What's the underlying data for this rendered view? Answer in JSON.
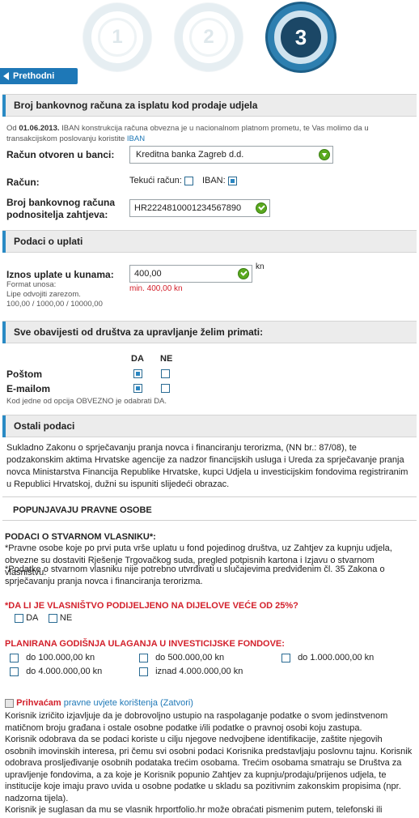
{
  "steps": [
    {
      "label": "1",
      "state": "done"
    },
    {
      "label": "2",
      "state": "done"
    },
    {
      "label": "3",
      "state": "active"
    }
  ],
  "back_button": "Prethodni korak",
  "bank_section": {
    "title": "Broj bankovnog računa za isplatu kod prodaje udjela",
    "note_prefix": "Od",
    "note_date": "01.06.2013.",
    "note_text": "IBAN konstrukcija računa obvezna je u nacionalnom platnom prometu, te Vas molimo da u transakcijskom poslovanju koristite",
    "note_link": "IBAN",
    "bank_label": "Račun otvoren u banci:",
    "bank_value": "Kreditna banka Zagreb d.d.",
    "account_label": "Račun:",
    "tekuci_label": "Tekući račun:",
    "tekuci_checked": false,
    "iban_label": "IBAN:",
    "iban_checked": true,
    "number_label_1": "Broj bankovnog računa",
    "number_label_2": "podnositelja zahtjeva:",
    "number_value": "HR2224810001234567890"
  },
  "payment_section": {
    "title": "Podaci o uplati",
    "amount_label": "Iznos uplate u kunama:",
    "amount_value": "400,00",
    "currency": "kn",
    "format_1": "Format unosa:",
    "format_2": "Lipe odvojiti zarezom.",
    "format_3": "100,00 / 1000,00 / 10000,00",
    "min_note": "min. 400,00 kn"
  },
  "notify_section": {
    "title": "Sve obavijesti od društva za upravljanje želim primati:",
    "col_yes": "DA",
    "col_no": "NE",
    "rows": [
      {
        "label": "Poštom",
        "yes": true,
        "no": false
      },
      {
        "label": "E-mailom",
        "yes": true,
        "no": false
      }
    ],
    "note": "Kod jedne od opcija OBVEZNO je odabrati DA."
  },
  "other_section": {
    "title": "Ostali podaci",
    "text": "Sukladno Zakonu o sprječavanju pranja novca i financiranju terorizma, (NN br.: 87/08), te podzakonskim aktima Hrvatske agencije za nadzor financijskih usluga i Ureda za sprječavanje pranja novca Ministarstva Financija Republike Hrvatske, kupci Udjela u investicijskim fondovima registriranim u Republici Hrvatskoj, dužni su ispuniti slijedeći obrazac.",
    "legal_heading": "POPUNJAVAJU PRAVNE OSOBE",
    "owner_heading": "PODACI O STVARNOM VLASNIKU*:",
    "owner_text_1": "*Pravne osobe koje po prvi puta vrše uplatu u fond pojedinog društva, uz Zahtjev za kupnju udjela, obvezne su dostaviti Rješenje Trgovačkog suda, pregled potpisnih kartona i Izjavu o stvarnom vlasništvu.",
    "owner_text_2": "*Podatke o stvarnom vlasniku nije potrebno utvrđivati u slučajevima predviđenim čl. 35 Zakona o sprječavanju pranja novca i financiranja terorizma.",
    "share_question": "*DA LI JE VLASNIŠTVO PODIJELJENO NA DIJELOVE VEĆE OD 25%?",
    "share_yes": "DA",
    "share_no": "NE",
    "invest_heading": "PLANIRANA GODIŠNJA ULAGANJA U INVESTICIJSKE FONDOVE:",
    "invest_options": [
      "do 100.000,00 kn",
      "do 500.000,00 kn",
      "do 1.000.000,00 kn",
      "do 4.000.000,00 kn",
      "iznad 4.000.000,00 kn"
    ]
  },
  "terms": {
    "accept_label": "Prihvaćam",
    "link_text": "pravne uvjete korištenja (Zatvori)",
    "p1": "Korisnik izričito izjavljuje da je dobrovoljno ustupio na raspolaganje podatke o svom jedinstvenom matičnom broju građana i ostale osobne podatke i/ili podatke o pravnoj osobi koju zastupa.",
    "p2": "Korisnik odobrava da se podaci koriste u cilju njegove nedvojbene identifikacije, zaštite njegovih osobnih imovinskih interesa, pri čemu svi osobni podaci Korisnika predstavljaju poslovnu tajnu. Korisnik odobrava prosljeđivanje osobnih podataka trećim osobama. Trećim osobama smatraju se Društva za upravljenje fondovima, a za koje je Korisnik popunio Zahtjev za kupnju/prodaju/prijenos udjela, te institucije koje imaju pravo uvida u osobne podatke u skladu sa pozitivnim zakonskim propisima (npr. nadzorna tijela).",
    "p3": "Korisnik je suglasan da mu se vlasnik hrportfolio.hr može obraćati pismenim putem, telefonski ili elektroničkom poštom kojima će ga obavještavati o novinama i pogodnostima u svojoj ponudi."
  }
}
